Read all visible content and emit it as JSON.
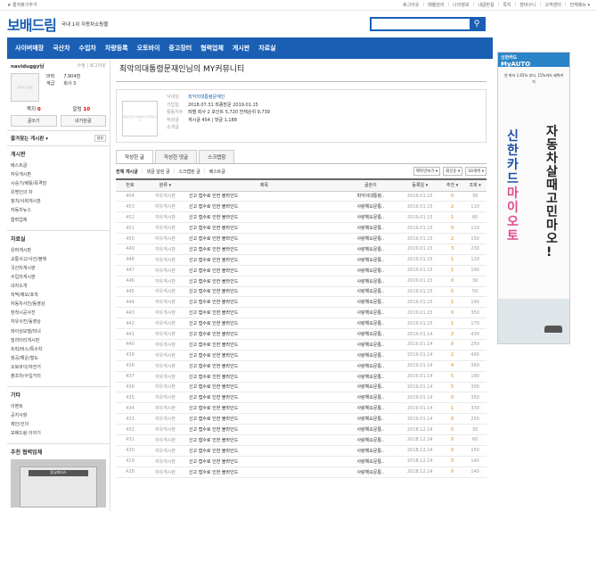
{
  "topbar": {
    "favorite": "★ 즐겨찾기추가",
    "links": [
      "로그아웃",
      "매물관리",
      "나의정보",
      "내글반응",
      "쪽지",
      "장바구니",
      "고객센터",
      "전체메뉴 ▾"
    ],
    "cart_count": "0"
  },
  "header": {
    "logo": "보배드림",
    "tagline": "국내 1위 자동차쇼핑몰",
    "search_placeholder": ""
  },
  "nav": [
    "사이버매장",
    "국산차",
    "수입차",
    "차량등록",
    "오토바이",
    "중고장터",
    "협력업체",
    "게시판",
    "자료실"
  ],
  "profile": {
    "nick": "naviduggy님",
    "links": "수정 | 로그아웃",
    "avatar_text": "회원사진 없음",
    "stats": [
      {
        "label": "마력",
        "value": "7,904점"
      },
      {
        "label": "계급",
        "value": "회사 3"
      }
    ],
    "counts": [
      {
        "label": "쪽지",
        "value": "0"
      },
      {
        "label": "알림",
        "value": "10"
      }
    ],
    "buttons": [
      "글쓰기",
      "내가쓴글"
    ]
  },
  "fav_board": {
    "title": "즐겨찾는 게시판 ▾",
    "setting": "설정"
  },
  "menus": [
    {
      "title": "게시판",
      "items": [
        "베스트글",
        "자유게시판",
        "시승기/배틀/목격담",
        "유명인의 차",
        "정치/사회게시판",
        "자동차뉴스",
        "협력업체"
      ]
    },
    {
      "title": "자료실",
      "items": [
        "유머게시판",
        "교통사고/사건/블랙",
        "국산차게시판",
        "수입차게시판",
        "내차소개",
        "직찍/제보/포착",
        "자동차사진/동영상",
        "장착시공사진",
        "자유사진/동영상",
        "레이싱모델/미녀",
        "밀리터리게시판",
        "트럭/버스/특수차",
        "항공/해운/철도",
        "오토바이/자전거",
        "출조차/수입거리"
      ]
    },
    {
      "title": "기타",
      "items": [
        "이벤트",
        "공지사항",
        "제안/건의",
        "보배드림 이야기"
      ]
    }
  ],
  "partner": {
    "title": "추천 협력업체",
    "sign": "튜닝파티스"
  },
  "page": {
    "title": "최악의대통령문재인님의 MY커뮤니티"
  },
  "info": {
    "img_text": "회원사진이 등록되지 않았습니다",
    "rows": [
      {
        "label": "닉네임",
        "value": "최악의대통령문재인"
      },
      {
        "label": "가입일",
        "value": "2018.07.31   최종방문 2019.01.15"
      },
      {
        "label": "활동지수",
        "value": "레벨 회사 2   포인트 5,720   전체순위 9,739"
      },
      {
        "label": "작성글",
        "value": "게시글 454 | 댓글 1,188"
      },
      {
        "label": "소개글",
        "value": ""
      }
    ]
  },
  "tabs": [
    "작성한 글",
    "작성한 댓글",
    "스크랩함"
  ],
  "filters": [
    "전체 게시글",
    "|",
    "댓글 달린 글",
    "|",
    "스크랩된 글",
    "|",
    "베스트글"
  ],
  "selects": [
    "제목만보기 ▾",
    "최신순 ▾",
    "50개씩 ▾"
  ],
  "table": {
    "headers": [
      "번호",
      "분류 ▾",
      "제목",
      "글쓴이",
      "등록일 ▾",
      "추천 ▾",
      "조회 ▾"
    ],
    "rows": [
      [
        "454",
        "자유게시판",
        "신고 접수로 인한 블라인드",
        "최악의대통령..",
        "2019.01.15",
        "0",
        "30"
      ],
      [
        "453",
        "자유게시판",
        "신고 접수로 인한 블라인드",
        "사랑해요문통..",
        "2019.01.15",
        "2",
        "110"
      ],
      [
        "452",
        "자유게시판",
        "신고 접수로 인한 블라인드",
        "사랑해요문통..",
        "2019.01.15",
        "1",
        "60"
      ],
      [
        "451",
        "자유게시판",
        "신고 접수로 인한 블라인드",
        "사랑해요문통..",
        "2019.01.15",
        "0",
        "110"
      ],
      [
        "450",
        "자유게시판",
        "신고 접수로 인한 블라인드",
        "사랑해요문통..",
        "2019.01.15",
        "2",
        "150"
      ],
      [
        "449",
        "자유게시판",
        "신고 접수로 인한 블라인드",
        "사랑해요문통..",
        "2019.01.15",
        "3",
        "230"
      ],
      [
        "448",
        "자유게시판",
        "신고 접수로 인한 블라인드",
        "사랑해요문통..",
        "2019.01.15",
        "1",
        "110"
      ],
      [
        "447",
        "자유게시판",
        "신고 접수로 인한 블라인드",
        "사랑해요문통..",
        "2019.01.15",
        "1",
        "190"
      ],
      [
        "446",
        "자유게시판",
        "신고 접수로 인한 블라인드",
        "사랑해요문통..",
        "2019.01.15",
        "0",
        "30"
      ],
      [
        "445",
        "자유게시판",
        "신고 접수로 인한 블라인드",
        "사랑해요문통..",
        "2019.01.15",
        "0",
        "50"
      ],
      [
        "444",
        "자유게시판",
        "신고 접수로 인한 블라인드",
        "사랑해요문통..",
        "2019.01.15",
        "1",
        "140"
      ],
      [
        "443",
        "자유게시판",
        "신고 접수로 인한 블라인드",
        "사랑해요문통..",
        "2019.01.15",
        "0",
        "350"
      ],
      [
        "442",
        "자유게시판",
        "신고 접수로 인한 블라인드",
        "사랑해요문통..",
        "2019.01.15",
        "1",
        "170"
      ],
      [
        "441",
        "자유게시판",
        "신고 접수로 인한 블라인드",
        "사랑해요문통..",
        "2019.01.14",
        "2",
        "430"
      ],
      [
        "440",
        "자유게시판",
        "신고 접수로 인한 블라인드",
        "사랑해요문통..",
        "2019.01.14",
        "0",
        "250"
      ],
      [
        "439",
        "자유게시판",
        "신고 접수로 인한 블라인드",
        "사랑해요문통..",
        "2019.01.14",
        "2",
        "490"
      ],
      [
        "438",
        "자유게시판",
        "신고 접수로 인한 블라인드",
        "사랑해요문통..",
        "2019.01.14",
        "4",
        "360"
      ],
      [
        "437",
        "자유게시판",
        "신고 접수로 인한 블라인드",
        "사랑해요문통..",
        "2019.01.14",
        "5",
        "190"
      ],
      [
        "436",
        "자유게시판",
        "신고 접수로 인한 블라인드",
        "사랑해요문통..",
        "2019.01.14",
        "5",
        "300"
      ],
      [
        "435",
        "자유게시판",
        "신고 접수로 인한 블라인드",
        "사랑해요문통..",
        "2019.01.14",
        "0",
        "350"
      ],
      [
        "434",
        "자유게시판",
        "신고 접수로 인한 블라인드",
        "사랑해요문통..",
        "2019.01.14",
        "1",
        "330"
      ],
      [
        "433",
        "자유게시판",
        "신고 접수로 인한 블라인드",
        "사랑해요문통..",
        "2019.01.14",
        "0",
        "250"
      ],
      [
        "432",
        "자유게시판",
        "신고 접수로 인한 블라인드",
        "사랑해요문통..",
        "2018.12.14",
        "0",
        "30"
      ],
      [
        "431",
        "자유게시판",
        "신고 접수로 인한 블라인드",
        "사랑해요문통..",
        "2018.12.14",
        "0",
        "60"
      ],
      [
        "430",
        "자유게시판",
        "신고 접수로 인한 블라인드",
        "사랑해요문통..",
        "2018.12.14",
        "0",
        "150"
      ],
      [
        "429",
        "자유게시판",
        "신고 접수로 인한 블라인드",
        "사랑해요문통..",
        "2018.12.14",
        "0",
        "140"
      ],
      [
        "428",
        "자유게시판",
        "신고 접수로 인한 블라인드",
        "사랑해요문통..",
        "2018.12.14",
        "0",
        "140"
      ]
    ]
  },
  "banner": {
    "brand": "신한카드",
    "product": "MyAUTO",
    "sub": "연 최저 1.65% 부터, 15%까지 혜택까지",
    "v1": [
      "신",
      "한",
      "카",
      "드",
      "마",
      "이",
      "오",
      "토"
    ],
    "v2": [
      "자",
      "동",
      "차",
      "살",
      "때",
      "고",
      "민",
      "마",
      "오",
      "!"
    ]
  }
}
